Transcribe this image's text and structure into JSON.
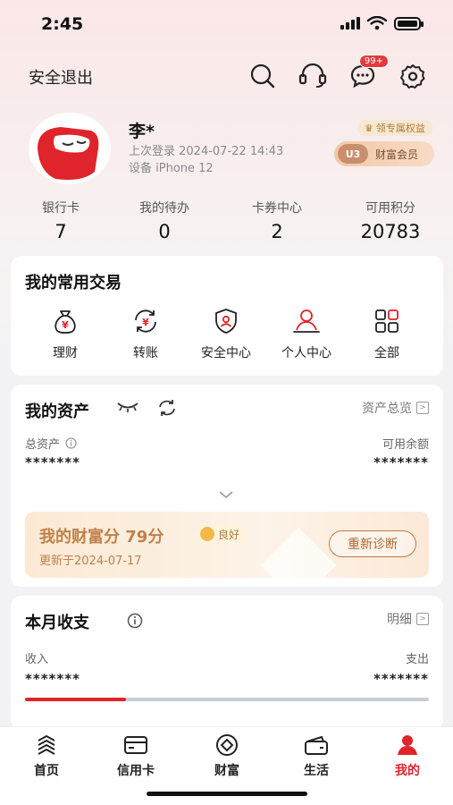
{
  "status": {
    "time": "2:45"
  },
  "topbar": {
    "logout_label": "安全退出",
    "message_badge": "99+"
  },
  "profile": {
    "name": "李*",
    "last_login": "上次登录 2024-07-22 14:43",
    "device": "设备 iPhone 12",
    "perk_label": "领专属权益",
    "member_level": "U3",
    "member_label": "财富会员"
  },
  "stats": [
    {
      "label": "银行卡",
      "value": "7"
    },
    {
      "label": "我的待办",
      "value": "0"
    },
    {
      "label": "卡券中心",
      "value": "2"
    },
    {
      "label": "可用积分",
      "value": "20783"
    }
  ],
  "quick": {
    "title": "我的常用交易",
    "items": [
      {
        "label": "理财",
        "icon": "money-bag-icon"
      },
      {
        "label": "转账",
        "icon": "transfer-icon"
      },
      {
        "label": "安全中心",
        "icon": "shield-icon"
      },
      {
        "label": "个人中心",
        "icon": "person-icon"
      },
      {
        "label": "全部",
        "icon": "grid-icon"
      }
    ]
  },
  "assets": {
    "title": "我的资产",
    "overview_label": "资产总览",
    "total_label": "总资产",
    "available_label": "可用余额",
    "total_value": "*******",
    "available_value": "*******"
  },
  "wealth": {
    "title": "我的财富分 79分",
    "tag": "良好",
    "updated": "更新于2024-07-17",
    "button": "重新诊断"
  },
  "monthly": {
    "title": "本月收支",
    "detail_label": "明细",
    "income_label": "收入",
    "expense_label": "支出",
    "income_value": "*******",
    "expense_value": "*******",
    "income_share": 0.25
  },
  "tabs": [
    {
      "label": "首页",
      "icon": "home-icon"
    },
    {
      "label": "信用卡",
      "icon": "credit-card-icon"
    },
    {
      "label": "财富",
      "icon": "wealth-icon"
    },
    {
      "label": "生活",
      "icon": "wallet-icon"
    },
    {
      "label": "我的",
      "icon": "profile-icon",
      "active": true
    }
  ],
  "colors": {
    "brand_red": "#e0242b",
    "gold": "#c0814a"
  }
}
